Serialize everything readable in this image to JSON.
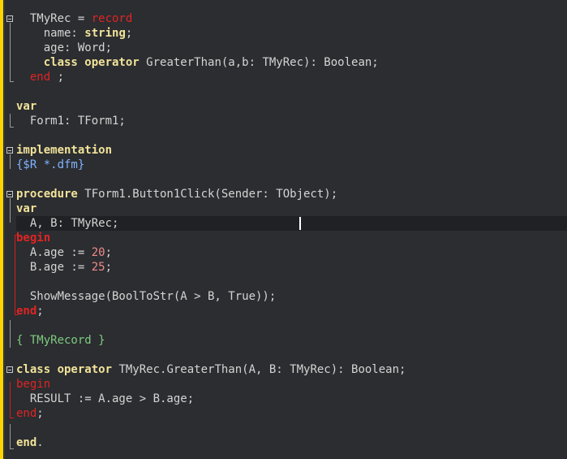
{
  "editor": {
    "lines": [
      {
        "indent": "  ",
        "parts": [
          [
            "id",
            "TMyRec = "
          ],
          [
            "rk",
            "record"
          ]
        ]
      },
      {
        "indent": "    ",
        "parts": [
          [
            "id",
            "name: "
          ],
          [
            "kw",
            "string"
          ],
          [
            "id",
            ";"
          ]
        ]
      },
      {
        "indent": "    ",
        "parts": [
          [
            "id",
            "age: Word;"
          ]
        ]
      },
      {
        "indent": "    ",
        "parts": [
          [
            "kw",
            "class operator"
          ],
          [
            "id",
            " GreaterThan(a,b: TMyRec): Boolean;"
          ]
        ]
      },
      {
        "indent": "  ",
        "parts": [
          [
            "rk",
            "end"
          ],
          [
            "id",
            " ;"
          ]
        ]
      },
      {
        "indent": "",
        "parts": []
      },
      {
        "indent": "",
        "parts": [
          [
            "kw",
            "var"
          ]
        ]
      },
      {
        "indent": "  ",
        "parts": [
          [
            "id",
            "Form1: TForm1;"
          ]
        ]
      },
      {
        "indent": "",
        "parts": []
      },
      {
        "indent": "",
        "parts": [
          [
            "kw",
            "implementation"
          ]
        ]
      },
      {
        "indent": "",
        "parts": [
          [
            "dir",
            "{$R *.dfm}"
          ]
        ]
      },
      {
        "indent": "",
        "parts": []
      },
      {
        "indent": "",
        "parts": [
          [
            "kw",
            "procedure"
          ],
          [
            "id",
            " TForm1.Button1Click(Sender: TObject);"
          ]
        ]
      },
      {
        "indent": "",
        "parts": [
          [
            "kw",
            "var"
          ]
        ]
      },
      {
        "indent": "  ",
        "parts": [
          [
            "id",
            "A, B: TMyRec;"
          ]
        ]
      },
      {
        "indent": "",
        "parts": [
          [
            "rk-bold",
            "begin"
          ]
        ]
      },
      {
        "indent": "  ",
        "parts": [
          [
            "id",
            "A.age := "
          ],
          [
            "num",
            "20"
          ],
          [
            "id",
            ";"
          ]
        ]
      },
      {
        "indent": "  ",
        "parts": [
          [
            "id",
            "B.age := "
          ],
          [
            "num",
            "25"
          ],
          [
            "id",
            ";"
          ]
        ]
      },
      {
        "indent": "",
        "parts": []
      },
      {
        "indent": "  ",
        "parts": [
          [
            "id",
            "ShowMessage(BoolToStr(A > B, True));"
          ]
        ]
      },
      {
        "indent": "",
        "parts": [
          [
            "rk-bold",
            "end"
          ],
          [
            "id",
            ";"
          ]
        ]
      },
      {
        "indent": "",
        "parts": []
      },
      {
        "indent": "",
        "parts": [
          [
            "cm",
            "{ TMyRecord }"
          ]
        ]
      },
      {
        "indent": "",
        "parts": []
      },
      {
        "indent": "",
        "parts": [
          [
            "kw",
            "class operator"
          ],
          [
            "id",
            " TMyRec.GreaterThan(A, B: TMyRec): Boolean;"
          ]
        ]
      },
      {
        "indent": "",
        "parts": [
          [
            "rk",
            "begin"
          ]
        ]
      },
      {
        "indent": "  ",
        "parts": [
          [
            "id",
            "RESULT := A.age > B.age;"
          ]
        ]
      },
      {
        "indent": "",
        "parts": [
          [
            "rk",
            "end"
          ],
          [
            "id",
            ";"
          ]
        ]
      },
      {
        "indent": "",
        "parts": []
      },
      {
        "indent": "",
        "parts": [
          [
            "kw",
            "end"
          ],
          [
            "id",
            "."
          ]
        ]
      }
    ],
    "colors": {
      "background": "#2b2d30",
      "keyword": "#f2e39a",
      "reserved_red": "#e02424",
      "number": "#f08a8a",
      "comment": "#7fca7f",
      "directive": "#7fb3ff",
      "gutter_marker": "#ffd400"
    }
  }
}
